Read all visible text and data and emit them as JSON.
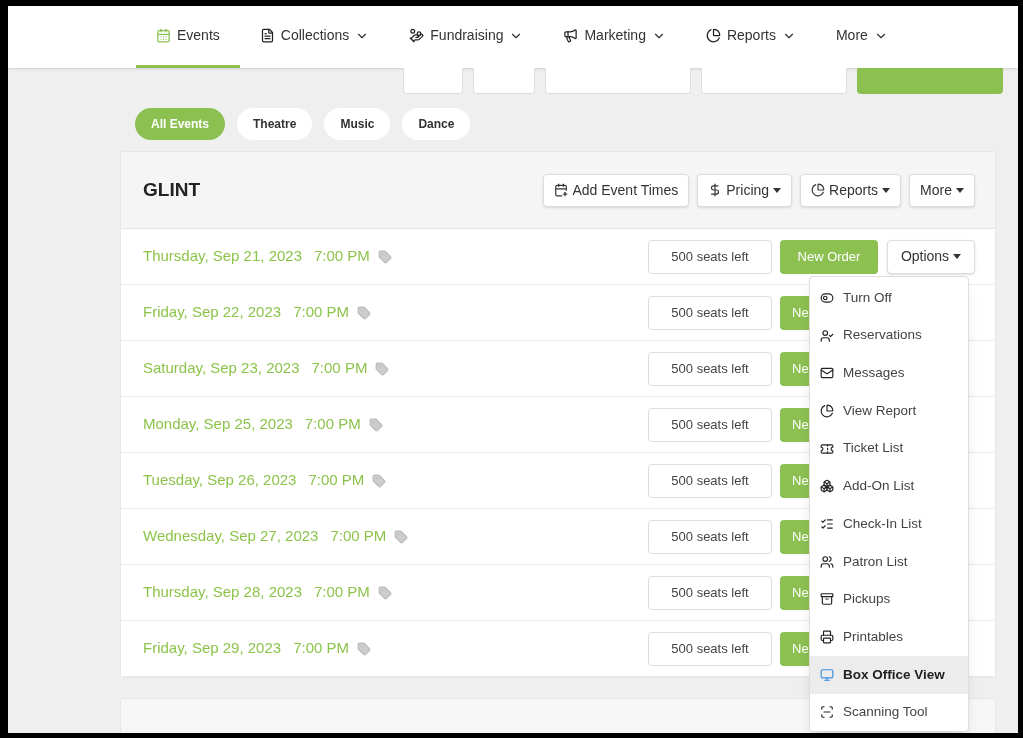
{
  "nav": [
    {
      "label": "Events",
      "selected": true
    },
    {
      "label": "Collections",
      "selected": false
    },
    {
      "label": "Fundraising",
      "selected": false
    },
    {
      "label": "Marketing",
      "selected": false
    },
    {
      "label": "Reports",
      "selected": false
    },
    {
      "label": "More",
      "selected": false
    }
  ],
  "toolbar": [
    {
      "kind": "plain"
    },
    {
      "kind": "plain"
    },
    {
      "kind": "plain"
    },
    {
      "kind": "plain"
    },
    {
      "kind": "primary"
    }
  ],
  "filters": [
    {
      "label": "All Events",
      "selected": true
    },
    {
      "label": "Theatre",
      "selected": false
    },
    {
      "label": "Music",
      "selected": false
    },
    {
      "label": "Dance",
      "selected": false
    }
  ],
  "event": {
    "title": "GLINT",
    "actions": [
      {
        "label": "Add Event Times"
      },
      {
        "label": "Pricing"
      },
      {
        "label": "Reports"
      },
      {
        "label": "More"
      }
    ],
    "times": [
      {
        "date": "Thursday, Sep 21, 2023",
        "time": "7:00 PM",
        "seats": "500 seats left",
        "new_order": "New Order",
        "options": "Options"
      },
      {
        "date": "Friday, Sep 22, 2023",
        "time": "7:00 PM",
        "seats": "500 seats left",
        "new_order": "Ne"
      },
      {
        "date": "Saturday, Sep 23, 2023",
        "time": "7:00 PM",
        "seats": "500 seats left",
        "new_order": "Ne"
      },
      {
        "date": "Monday, Sep 25, 2023",
        "time": "7:00 PM",
        "seats": "500 seats left",
        "new_order": "Ne"
      },
      {
        "date": "Tuesday, Sep 26, 2023",
        "time": "7:00 PM",
        "seats": "500 seats left",
        "new_order": "Ne"
      },
      {
        "date": "Wednesday, Sep 27, 2023",
        "time": "7:00 PM",
        "seats": "500 seats left",
        "new_order": "Ne"
      },
      {
        "date": "Thursday, Sep 28, 2023",
        "time": "7:00 PM",
        "seats": "500 seats left",
        "new_order": "Ne"
      },
      {
        "date": "Friday, Sep 29, 2023",
        "time": "7:00 PM",
        "seats": "500 seats left",
        "new_order": "Ne"
      }
    ]
  },
  "options_menu": [
    {
      "label": "Turn Off",
      "selected": false
    },
    {
      "label": "Reservations",
      "selected": false
    },
    {
      "label": "Messages",
      "selected": false
    },
    {
      "label": "View Report",
      "selected": false
    },
    {
      "label": "Ticket List",
      "selected": false
    },
    {
      "label": "Add-On List",
      "selected": false
    },
    {
      "label": "Check-In List",
      "selected": false
    },
    {
      "label": "Patron List",
      "selected": false
    },
    {
      "label": "Pickups",
      "selected": false
    },
    {
      "label": "Printables",
      "selected": false
    },
    {
      "label": "Box Office View",
      "selected": true
    },
    {
      "label": "Scanning Tool",
      "selected": false
    }
  ]
}
